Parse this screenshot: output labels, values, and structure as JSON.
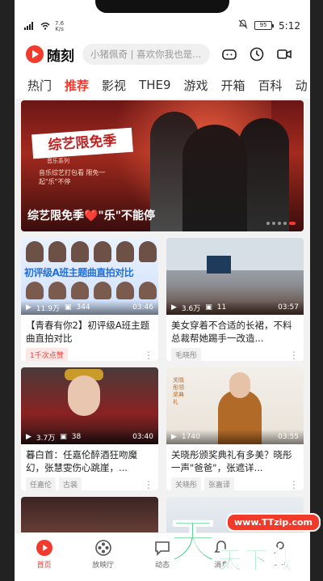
{
  "status": {
    "signal_text": "4G",
    "speed_top": "7.6",
    "speed_unit": "K/s",
    "battery": "95",
    "time": "5:12"
  },
  "header": {
    "app_name": "随刻",
    "search_placeholder": "小猪佩奇 | 喜欢你我也是..."
  },
  "tabs": [
    "热门",
    "推荐",
    "影视",
    "THE9",
    "游戏",
    "开箱",
    "百科",
    "动"
  ],
  "active_tab": "推荐",
  "banner": {
    "promo_title": "综艺限免季",
    "promo_sub": "音乐系列",
    "promo_small": "音乐综艺打包看 限免一起\"乐\"不停",
    "caption": "综艺限免季❤️\"乐\"不能停"
  },
  "cards": [
    {
      "thumb_headline": "初评级A班主题曲直拍对比",
      "plays": "11.9万",
      "comments": "344",
      "duration": "03:46",
      "title": "【青春有你2】初评级A班主题曲直拍对比",
      "tags": [
        "1千次点赞"
      ]
    },
    {
      "plays": "3.6万",
      "comments": "11",
      "duration": "03:57",
      "title": "美女穿着不合适的长裙，不料总裁帮她踢手一改造...",
      "tags": [
        "毛晓彤"
      ]
    },
    {
      "plays": "3.7万",
      "comments": "38",
      "duration": "03:40",
      "title": "暮白首：任嘉伦醉酒狂吻魔幻，张慧雯伤心跳崖，...",
      "tags": [
        "任嘉伦",
        "古装"
      ]
    },
    {
      "thumb_headline": "关晓彤领奖典礼",
      "plays": "1740",
      "comments": "",
      "duration": "03:55",
      "title": "关晓彤颁奖典礼有多美？晓彤一声\"爸爸\"，张遮详...",
      "tags": [
        "关晓彤",
        "张嘉译"
      ]
    }
  ],
  "nav": [
    "首页",
    "放映厅",
    "动态",
    "消息",
    "我的"
  ],
  "watermark": {
    "big": "天",
    "url": "www.TTzip.com",
    "small": "天下载"
  }
}
